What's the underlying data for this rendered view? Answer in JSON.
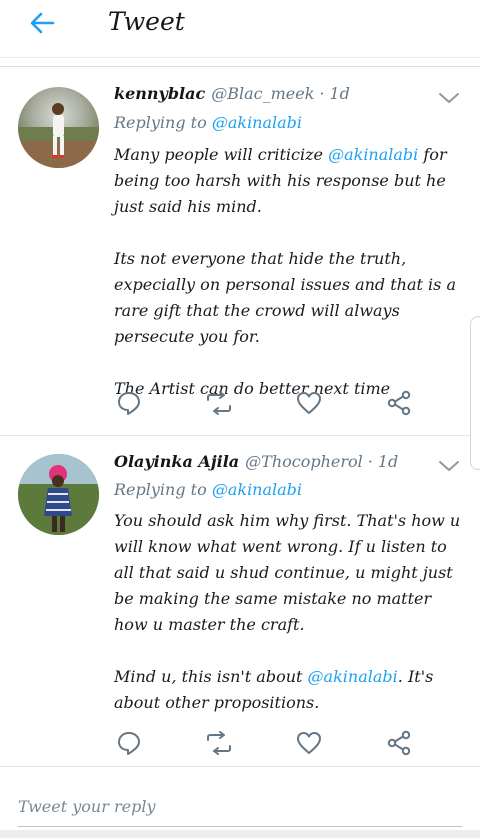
{
  "header": {
    "title": "Tweet",
    "back_icon": "arrow-left-icon",
    "accent": "#1da1f2"
  },
  "tweets": [
    {
      "display_name": "kennyblac",
      "handle": "@Blac_meek",
      "separator": "·",
      "time": "1d",
      "replying_prefix": "Replying to",
      "replying_to": "@akinalabi",
      "paragraphs": [
        {
          "before": "Many people will criticize ",
          "mention": "@akinalabi",
          "after": " for being too harsh with his response but he just said his mind."
        },
        {
          "before": "Its not everyone that hide the truth, expecially on personal issues and that is a rare gift that the crowd will always persecute you for.",
          "mention": "",
          "after": ""
        },
        {
          "before": "The Artist can do better next time",
          "mention": "",
          "after": ""
        }
      ]
    },
    {
      "display_name": "Olayinka Ajila",
      "handle": "@Thocopherol",
      "separator": "·",
      "time": "1d",
      "replying_prefix": "Replying to",
      "replying_to": "@akinalabi",
      "paragraphs": [
        {
          "before": "You should ask him why first. That's how u will know what went wrong. If u listen to all that said u shud continue, u might just be making the same mistake no matter how u master the craft.",
          "mention": "",
          "after": ""
        },
        {
          "before": "Mind u, this isn't about ",
          "mention": "@akinalabi",
          "after": ". It's about other propositions."
        }
      ]
    }
  ],
  "actions": {
    "reply_icon": "reply-icon",
    "retweet_icon": "retweet-icon",
    "like_icon": "heart-icon",
    "share_icon": "share-icon"
  },
  "composer": {
    "placeholder": "Tweet your reply",
    "value": ""
  }
}
